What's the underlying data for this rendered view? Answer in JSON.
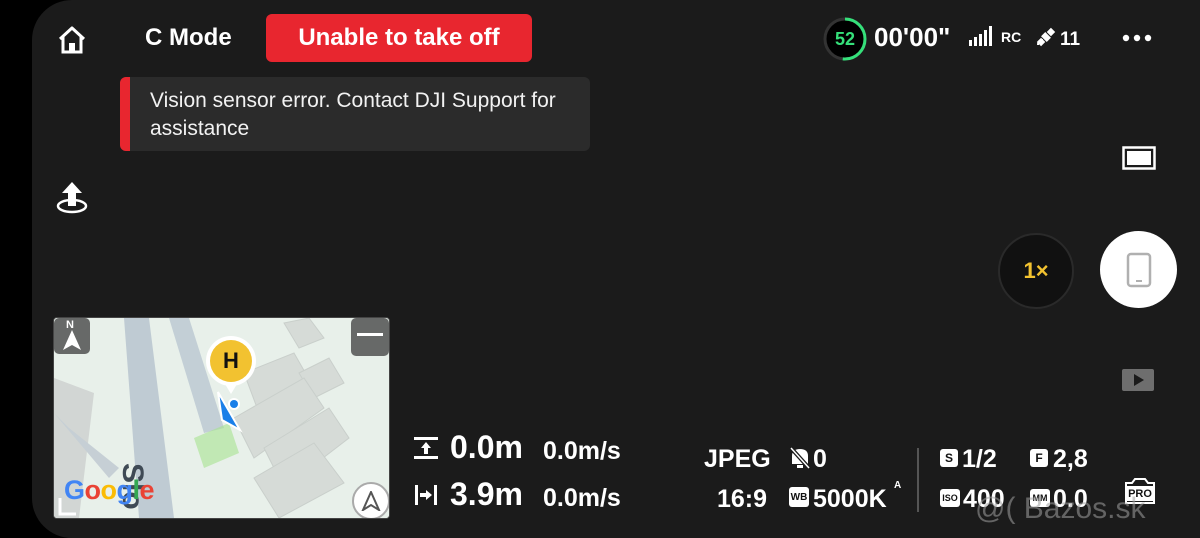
{
  "status_bar": {
    "mode_label": "C Mode",
    "alert_label": "Unable to take off",
    "battery_percent": "52",
    "flight_time": "00'00\"",
    "rc_label": "RC",
    "satellite_count": "11"
  },
  "toast": {
    "message": "Vision sensor error. Contact DJI Support for assistance"
  },
  "colors": {
    "alert_red": "#e8262f",
    "battery_green": "#35e07a",
    "zoom_yellow": "#f2c230",
    "panel_bg": "#1b1b1b"
  },
  "camera": {
    "zoom_label": "1×",
    "pro_label": "PRO"
  },
  "map": {
    "home_marker_label": "H",
    "north_label": "N",
    "street_fragment": "Slo",
    "attribution": "Google"
  },
  "telemetry": {
    "height_value": "0.0m",
    "vertical_speed": "0.0m/s",
    "distance_value": "3.9m",
    "horizontal_speed": "0.0m/s"
  },
  "camera_settings": {
    "format": "JPEG",
    "flash_count": "0",
    "aspect_ratio": "16:9",
    "white_balance": "5000K",
    "white_balance_mode": "A",
    "shutter_badge": "S",
    "shutter": "1/2",
    "aperture_badge": "F",
    "aperture": "2,8",
    "iso_badge": "ISO",
    "iso": "400",
    "ev_badge": "MM",
    "ev": "0.0",
    "wb_badge": "WB"
  },
  "watermark": "@( Bazos.sk"
}
